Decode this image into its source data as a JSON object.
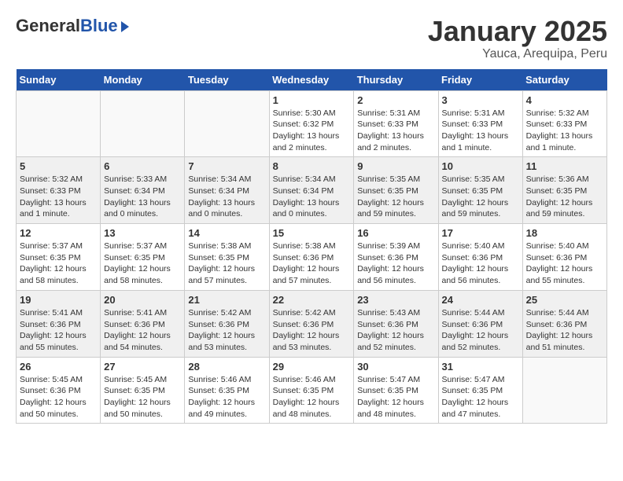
{
  "header": {
    "logo_general": "General",
    "logo_blue": "Blue",
    "title": "January 2025",
    "subtitle": "Yauca, Arequipa, Peru"
  },
  "weekdays": [
    "Sunday",
    "Monday",
    "Tuesday",
    "Wednesday",
    "Thursday",
    "Friday",
    "Saturday"
  ],
  "weeks": [
    [
      {
        "day": "",
        "sunrise": "",
        "sunset": "",
        "daylight": ""
      },
      {
        "day": "",
        "sunrise": "",
        "sunset": "",
        "daylight": ""
      },
      {
        "day": "",
        "sunrise": "",
        "sunset": "",
        "daylight": ""
      },
      {
        "day": "1",
        "sunrise": "Sunrise: 5:30 AM",
        "sunset": "Sunset: 6:32 PM",
        "daylight": "Daylight: 13 hours and 2 minutes."
      },
      {
        "day": "2",
        "sunrise": "Sunrise: 5:31 AM",
        "sunset": "Sunset: 6:33 PM",
        "daylight": "Daylight: 13 hours and 2 minutes."
      },
      {
        "day": "3",
        "sunrise": "Sunrise: 5:31 AM",
        "sunset": "Sunset: 6:33 PM",
        "daylight": "Daylight: 13 hours and 1 minute."
      },
      {
        "day": "4",
        "sunrise": "Sunrise: 5:32 AM",
        "sunset": "Sunset: 6:33 PM",
        "daylight": "Daylight: 13 hours and 1 minute."
      }
    ],
    [
      {
        "day": "5",
        "sunrise": "Sunrise: 5:32 AM",
        "sunset": "Sunset: 6:33 PM",
        "daylight": "Daylight: 13 hours and 1 minute."
      },
      {
        "day": "6",
        "sunrise": "Sunrise: 5:33 AM",
        "sunset": "Sunset: 6:34 PM",
        "daylight": "Daylight: 13 hours and 0 minutes."
      },
      {
        "day": "7",
        "sunrise": "Sunrise: 5:34 AM",
        "sunset": "Sunset: 6:34 PM",
        "daylight": "Daylight: 13 hours and 0 minutes."
      },
      {
        "day": "8",
        "sunrise": "Sunrise: 5:34 AM",
        "sunset": "Sunset: 6:34 PM",
        "daylight": "Daylight: 13 hours and 0 minutes."
      },
      {
        "day": "9",
        "sunrise": "Sunrise: 5:35 AM",
        "sunset": "Sunset: 6:35 PM",
        "daylight": "Daylight: 12 hours and 59 minutes."
      },
      {
        "day": "10",
        "sunrise": "Sunrise: 5:35 AM",
        "sunset": "Sunset: 6:35 PM",
        "daylight": "Daylight: 12 hours and 59 minutes."
      },
      {
        "day": "11",
        "sunrise": "Sunrise: 5:36 AM",
        "sunset": "Sunset: 6:35 PM",
        "daylight": "Daylight: 12 hours and 59 minutes."
      }
    ],
    [
      {
        "day": "12",
        "sunrise": "Sunrise: 5:37 AM",
        "sunset": "Sunset: 6:35 PM",
        "daylight": "Daylight: 12 hours and 58 minutes."
      },
      {
        "day": "13",
        "sunrise": "Sunrise: 5:37 AM",
        "sunset": "Sunset: 6:35 PM",
        "daylight": "Daylight: 12 hours and 58 minutes."
      },
      {
        "day": "14",
        "sunrise": "Sunrise: 5:38 AM",
        "sunset": "Sunset: 6:35 PM",
        "daylight": "Daylight: 12 hours and 57 minutes."
      },
      {
        "day": "15",
        "sunrise": "Sunrise: 5:38 AM",
        "sunset": "Sunset: 6:36 PM",
        "daylight": "Daylight: 12 hours and 57 minutes."
      },
      {
        "day": "16",
        "sunrise": "Sunrise: 5:39 AM",
        "sunset": "Sunset: 6:36 PM",
        "daylight": "Daylight: 12 hours and 56 minutes."
      },
      {
        "day": "17",
        "sunrise": "Sunrise: 5:40 AM",
        "sunset": "Sunset: 6:36 PM",
        "daylight": "Daylight: 12 hours and 56 minutes."
      },
      {
        "day": "18",
        "sunrise": "Sunrise: 5:40 AM",
        "sunset": "Sunset: 6:36 PM",
        "daylight": "Daylight: 12 hours and 55 minutes."
      }
    ],
    [
      {
        "day": "19",
        "sunrise": "Sunrise: 5:41 AM",
        "sunset": "Sunset: 6:36 PM",
        "daylight": "Daylight: 12 hours and 55 minutes."
      },
      {
        "day": "20",
        "sunrise": "Sunrise: 5:41 AM",
        "sunset": "Sunset: 6:36 PM",
        "daylight": "Daylight: 12 hours and 54 minutes."
      },
      {
        "day": "21",
        "sunrise": "Sunrise: 5:42 AM",
        "sunset": "Sunset: 6:36 PM",
        "daylight": "Daylight: 12 hours and 53 minutes."
      },
      {
        "day": "22",
        "sunrise": "Sunrise: 5:42 AM",
        "sunset": "Sunset: 6:36 PM",
        "daylight": "Daylight: 12 hours and 53 minutes."
      },
      {
        "day": "23",
        "sunrise": "Sunrise: 5:43 AM",
        "sunset": "Sunset: 6:36 PM",
        "daylight": "Daylight: 12 hours and 52 minutes."
      },
      {
        "day": "24",
        "sunrise": "Sunrise: 5:44 AM",
        "sunset": "Sunset: 6:36 PM",
        "daylight": "Daylight: 12 hours and 52 minutes."
      },
      {
        "day": "25",
        "sunrise": "Sunrise: 5:44 AM",
        "sunset": "Sunset: 6:36 PM",
        "daylight": "Daylight: 12 hours and 51 minutes."
      }
    ],
    [
      {
        "day": "26",
        "sunrise": "Sunrise: 5:45 AM",
        "sunset": "Sunset: 6:36 PM",
        "daylight": "Daylight: 12 hours and 50 minutes."
      },
      {
        "day": "27",
        "sunrise": "Sunrise: 5:45 AM",
        "sunset": "Sunset: 6:35 PM",
        "daylight": "Daylight: 12 hours and 50 minutes."
      },
      {
        "day": "28",
        "sunrise": "Sunrise: 5:46 AM",
        "sunset": "Sunset: 6:35 PM",
        "daylight": "Daylight: 12 hours and 49 minutes."
      },
      {
        "day": "29",
        "sunrise": "Sunrise: 5:46 AM",
        "sunset": "Sunset: 6:35 PM",
        "daylight": "Daylight: 12 hours and 48 minutes."
      },
      {
        "day": "30",
        "sunrise": "Sunrise: 5:47 AM",
        "sunset": "Sunset: 6:35 PM",
        "daylight": "Daylight: 12 hours and 48 minutes."
      },
      {
        "day": "31",
        "sunrise": "Sunrise: 5:47 AM",
        "sunset": "Sunset: 6:35 PM",
        "daylight": "Daylight: 12 hours and 47 minutes."
      },
      {
        "day": "",
        "sunrise": "",
        "sunset": "",
        "daylight": ""
      }
    ]
  ]
}
